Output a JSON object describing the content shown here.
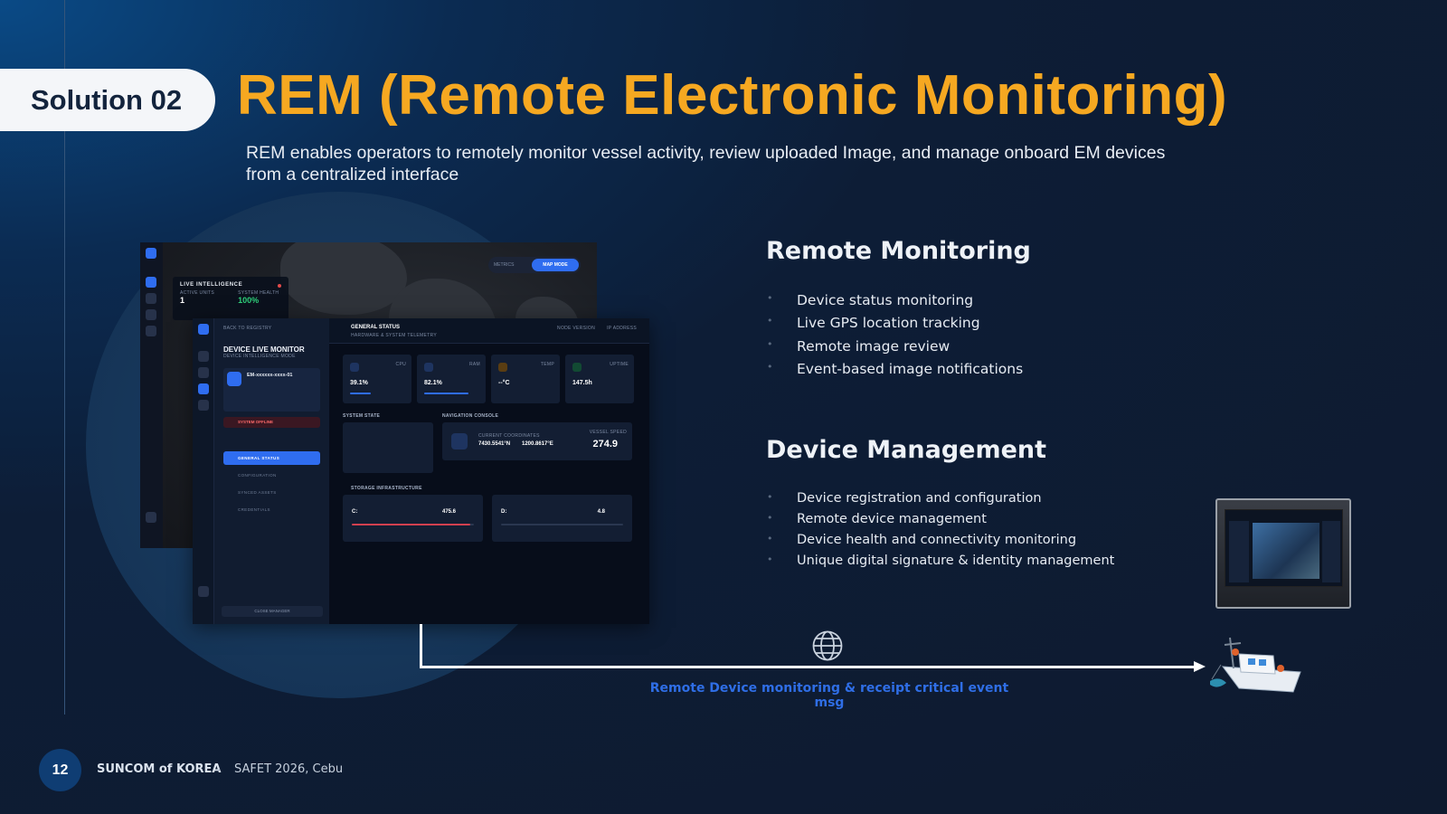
{
  "slide": {
    "badge_label": "Solution 02",
    "title": "REM (Remote Electronic Monitoring)",
    "subtitle": "REM enables operators to remotely monitor vessel activity, review uploaded Image, and manage onboard EM devices from a centralized interface"
  },
  "screenshot_map": {
    "segment_metrics": "METRICS",
    "segment_map": "MAP MODE",
    "live_card_title": "LIVE INTELLIGENCE",
    "active_units_label": "ACTIVE UNITS",
    "active_units_value": "1",
    "system_health_label": "SYSTEM HEALTH",
    "system_health_value": "100%"
  },
  "screenshot_monitor": {
    "back_link": "BACK TO REGISTRY",
    "title": "DEVICE LIVE MONITOR",
    "title_sub": "DEVICE INTELLIGENCE MODE",
    "device_id": "EM-xxxxxx-xxxx-01",
    "status": "SYSTEM OFFLINE",
    "nav": [
      "GENERAL STATUS",
      "CONFIGURATION",
      "SYNCED ASSETS",
      "CREDENTIALS"
    ],
    "close_button": "CLOSE MANAGER",
    "header_title": "GENERAL STATUS",
    "header_sub": "HARDWARE & SYSTEM TELEMETRY",
    "node_version_label": "NODE VERSION",
    "ip_label": "IP ADDRESS",
    "stats": [
      {
        "label": "CPU",
        "value": "39.1%",
        "fill": 0.39,
        "color": "#2f6df0"
      },
      {
        "label": "RAM",
        "value": "82.1%",
        "fill": 0.82,
        "color": "#2f6df0"
      },
      {
        "label": "TEMP",
        "value": "--°C",
        "fill": 0,
        "color": "#d99b2a"
      },
      {
        "label": "UPTIME",
        "value": "147.5h",
        "fill": 0,
        "color": "#2faa6b"
      }
    ],
    "system_state_label": "SYSTEM STATE",
    "nav_console_label": "NAVIGATION CONSOLE",
    "coordinates_label": "CURRENT COORDINATES",
    "latitude": "7430.5541°N",
    "longitude": "1200.8617°E",
    "speed_label": "VESSEL SPEED",
    "speed_value": "274.9",
    "storage_label": "STORAGE INFRASTRUCTURE",
    "partition_c": "C:",
    "capacity_c": "475.6",
    "fill_c": 0.97,
    "partition_d": "D:",
    "capacity_d": "4.8",
    "fill_d": 0
  },
  "remote_monitoring": {
    "heading": "Remote Monitoring",
    "items": [
      "Device status monitoring",
      "Live GPS location tracking",
      "Remote image review",
      "Event-based image notifications"
    ]
  },
  "device_management": {
    "heading": "Device Management",
    "items": [
      "Device registration and configuration",
      "Remote device management",
      "Device health and connectivity monitoring",
      "Unique digital signature & identity management"
    ]
  },
  "flow": {
    "caption": "Remote Device monitoring & receipt critical event msg",
    "icon": "globe-icon"
  },
  "footer": {
    "page_number": "12",
    "org": "SUNCOM of KOREA",
    "separator": "·",
    "event": "SAFET 2026, Cebu"
  },
  "colors": {
    "accent": "#f6a821",
    "link": "#2f6ee6",
    "background": "#0e1a2f"
  }
}
